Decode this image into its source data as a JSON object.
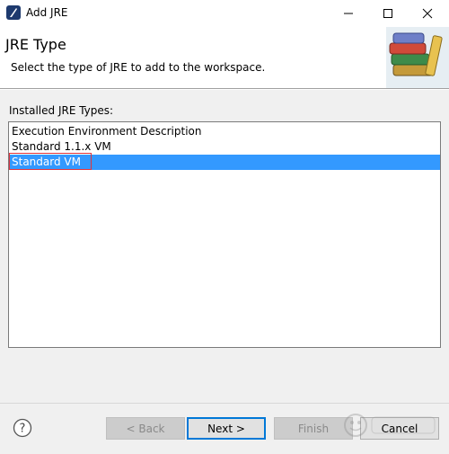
{
  "window": {
    "title": "Add JRE",
    "controls": {
      "minimize": "minimize-icon",
      "maximize": "maximize-icon",
      "close": "close-icon"
    }
  },
  "banner": {
    "title": "JRE Type",
    "description": "Select the type of JRE to add to the workspace.",
    "image_icon": "books-icon"
  },
  "list": {
    "label": "Installed JRE Types:",
    "items": [
      {
        "label": "Execution Environment Description"
      },
      {
        "label": "Standard 1.1.x VM"
      },
      {
        "label": "Standard VM"
      }
    ],
    "selected_index": 2
  },
  "buttons": {
    "help_icon": "help-icon",
    "back": "< Back",
    "next": "Next >",
    "finish": "Finish",
    "cancel": "Cancel"
  },
  "colors": {
    "selection": "#3399ff",
    "highlight_outline": "#e0333a",
    "default_button_border": "#0078d7"
  }
}
